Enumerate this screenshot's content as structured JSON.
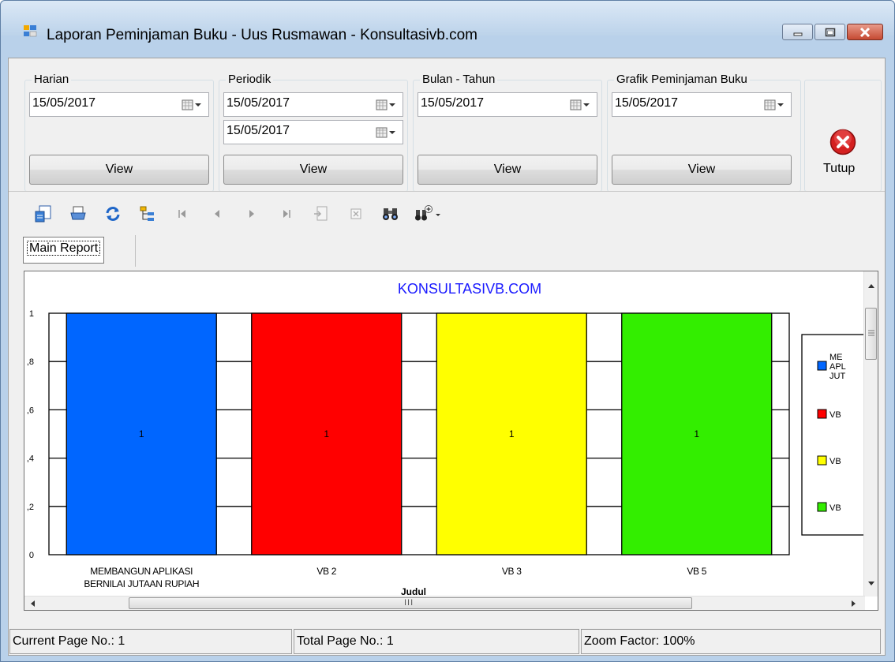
{
  "window": {
    "title": "Laporan Peminjaman Buku - Uus Rusmawan - Konsultasivb.com"
  },
  "groups": {
    "harian": {
      "label": "Harian",
      "date": "15/05/2017",
      "button": "View"
    },
    "periodik": {
      "label": "Periodik",
      "date_from": "15/05/2017",
      "date_to": "15/05/2017",
      "button": "View"
    },
    "bulan_tahun": {
      "label": "Bulan - Tahun",
      "date": "15/05/2017",
      "button": "View"
    },
    "grafik": {
      "label": "Grafik Peminjaman Buku",
      "date": "15/05/2017",
      "button": "View"
    }
  },
  "close_button": {
    "label": "Tutup"
  },
  "report_tab": {
    "label": "Main Report"
  },
  "chart_data": {
    "type": "bar",
    "title": "KONSULTASIVB.COM",
    "xlabel": "Judul",
    "ylabel": "",
    "categories": [
      "MEMBANGUN APLIKASI BERNILAI JUTAAN RUPIAH",
      "VB 2",
      "VB 3",
      "VB 5"
    ],
    "category_lines": [
      [
        "MEMBANGUN APLIKASI",
        "BERNILAI JUTAAN RUPIAH"
      ],
      [
        "VB 2"
      ],
      [
        "VB 3"
      ],
      [
        "VB 5"
      ]
    ],
    "values": [
      1,
      1,
      1,
      1
    ],
    "data_labels": [
      "1",
      "1",
      "1",
      "1"
    ],
    "colors": [
      "#0066ff",
      "#ff0000",
      "#ffff00",
      "#33ee00"
    ],
    "ylim": [
      0,
      1
    ],
    "yticks": [
      0,
      0.2,
      0.4,
      0.6,
      0.8,
      1
    ],
    "ytick_labels": [
      "0",
      ",2",
      ",4",
      ",6",
      ",8",
      "1"
    ],
    "grid": true,
    "legend_position": "right",
    "legend": [
      {
        "lines": [
          "ME",
          "APL",
          "JUT"
        ],
        "color": "#0066ff"
      },
      {
        "lines": [
          "VB"
        ],
        "color": "#ff0000"
      },
      {
        "lines": [
          "VB"
        ],
        "color": "#ffff00"
      },
      {
        "lines": [
          "VB"
        ],
        "color": "#33ee00"
      }
    ]
  },
  "scrollbar": {
    "h_thumb_grip": "III"
  },
  "status": {
    "current_page": "Current Page No.: 1",
    "total_page": "Total Page No.: 1",
    "zoom": "Zoom Factor: 100%"
  }
}
